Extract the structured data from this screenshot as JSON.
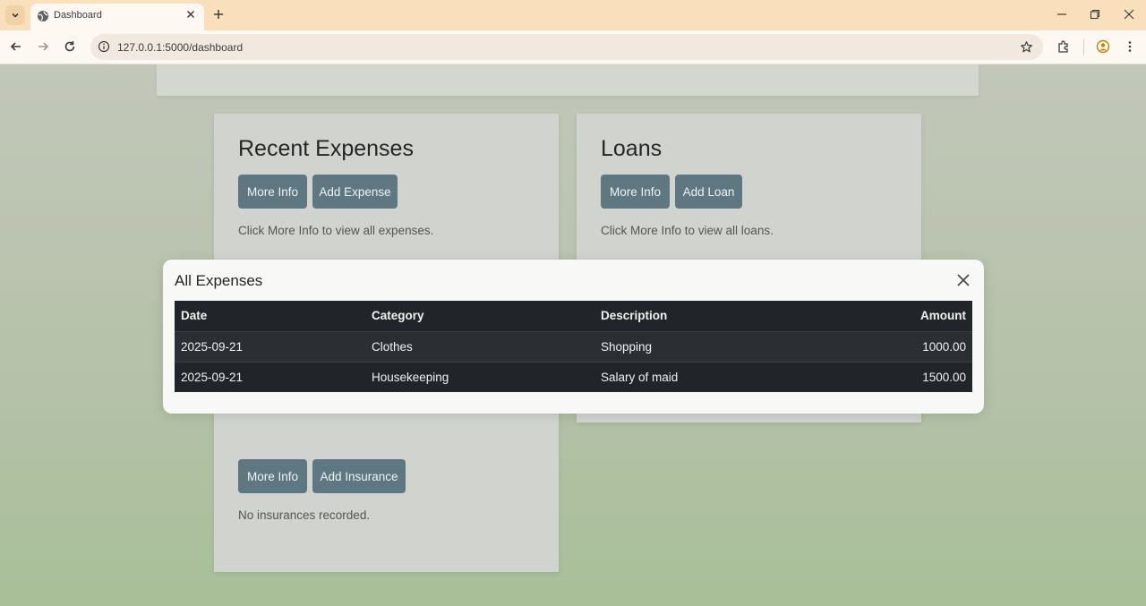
{
  "browser": {
    "tab_title": "Dashboard",
    "url": "127.0.0.1:5000/dashboard"
  },
  "cards": {
    "expenses": {
      "title": "Recent Expenses",
      "more_info": "More Info",
      "add_label": "Add Expense",
      "note": "Click More Info to view all expenses."
    },
    "loans": {
      "title": "Loans",
      "more_info": "More Info",
      "add_label": "Add Loan",
      "note": "Click More Info to view all loans."
    },
    "insurance": {
      "more_info": "More Info",
      "add_label": "Add Insurance",
      "note": "No insurances recorded."
    }
  },
  "modal": {
    "title": "All Expenses",
    "headers": {
      "date": "Date",
      "category": "Category",
      "description": "Description",
      "amount": "Amount"
    },
    "rows": [
      {
        "date": "2025-09-21",
        "category": "Clothes",
        "description": "Shopping",
        "amount": "1000.00"
      },
      {
        "date": "2025-09-21",
        "category": "Housekeeping",
        "description": "Salary of maid",
        "amount": "1500.00"
      }
    ]
  },
  "colors": {
    "tab_bar": "#f9dfbb",
    "button": "#5e7781",
    "table_header": "#212529"
  }
}
